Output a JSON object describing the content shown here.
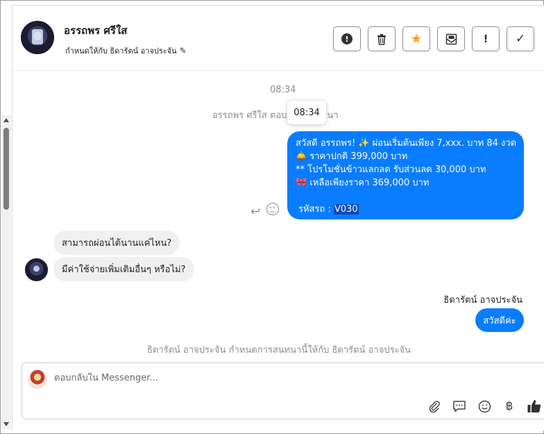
{
  "header": {
    "contact_name": "อรรถพร ศรีใส",
    "assign_label": "กำหนดให้กับ ธิดารัตน์ อาจประจัน",
    "actions": [
      {
        "name": "spam",
        "icon": "alert-circle-icon"
      },
      {
        "name": "delete",
        "icon": "trash-icon"
      },
      {
        "name": "star",
        "icon": "star-icon"
      },
      {
        "name": "mark-unread",
        "icon": "envelope-icon"
      },
      {
        "name": "important",
        "icon": "exclamation-icon"
      },
      {
        "name": "done",
        "icon": "check-icon"
      }
    ]
  },
  "conversation": {
    "time_divider": "08:34",
    "tooltip_time": "08:34",
    "system_top_left": "อรรถพร ศรีใส ตอบ",
    "system_top_right": "นา",
    "outgoing_big": {
      "lines": [
        "สวัสดี อรรถพร! ✨  ผ่อนเริ่มต้นเพียง 7,xxx. บาท 84 งวด",
        "🛎️ ราคาปกติ 399,000 บาท",
        "** โปรโมชั่นข้าวแลกลด รับส่วนลด 30,000 บาท",
        "🎀  เหลือเพียงราคา 369,000 บาท"
      ],
      "code_label": "รหัสรถ : ",
      "code_value": "V030"
    },
    "incoming": [
      "สามารถผ่อนได้นานแค่ไหน?",
      "มีค่าใช้จ่ายเพิ่มเติมอื่นๆ หรือไม่?"
    ],
    "sender_name": "ธิดารัตน์ อาจประจัน",
    "outgoing_small": "สวัสดีค่ะ",
    "system_bottom": "ธิดารัตน์ อาจประจัน กำหนดการสนทนานี้ให้กับ ธิดารัตน์ อาจประจัน"
  },
  "composer": {
    "placeholder": "ตอบกลับใน Messenger...",
    "value": "",
    "tools": [
      "paperclip-icon",
      "saved-replies-icon",
      "emoji-icon",
      "baht-icon",
      "thumbs-up-icon"
    ],
    "baht_symbol": "฿"
  },
  "colors": {
    "outgoing_bubble": "#0a7cff",
    "incoming_bubble": "#f0f0f0",
    "star": "#f5a623"
  }
}
